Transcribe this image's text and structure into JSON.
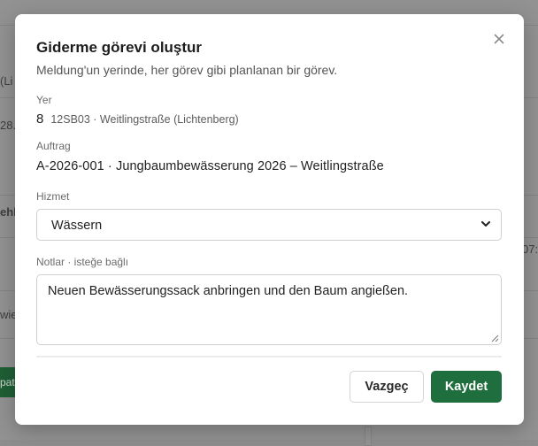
{
  "background": {
    "fragments": [
      "(Li",
      "28.0",
      "ehl",
      "wie",
      "07:",
      "pat"
    ]
  },
  "modal": {
    "title": "Giderme görevi oluştur",
    "subtitle": "Meldung'un yerinde, her görev gibi planlanan bir görev.",
    "close_icon": "close-icon",
    "location": {
      "label": "Yer",
      "number": "8",
      "detail": "12SB03 · Weitlingstraße (Lichtenberg)"
    },
    "order": {
      "label": "Auftrag",
      "value": "A-2026-001 · Jungbaumbewässerung 2026 – Weitlingstraße"
    },
    "service": {
      "label": "Hizmet",
      "selected": "Wässern",
      "chevron_icon": "chevron-down-icon"
    },
    "notes": {
      "label": "Notlar · isteğe bağlı",
      "value": "Neuen Bewässerungssack anbringen und den Baum angießen."
    },
    "buttons": {
      "cancel": "Vazgeç",
      "save": "Kaydet"
    }
  },
  "colors": {
    "primary": "#1f6e3d",
    "overlay": "#929292"
  }
}
